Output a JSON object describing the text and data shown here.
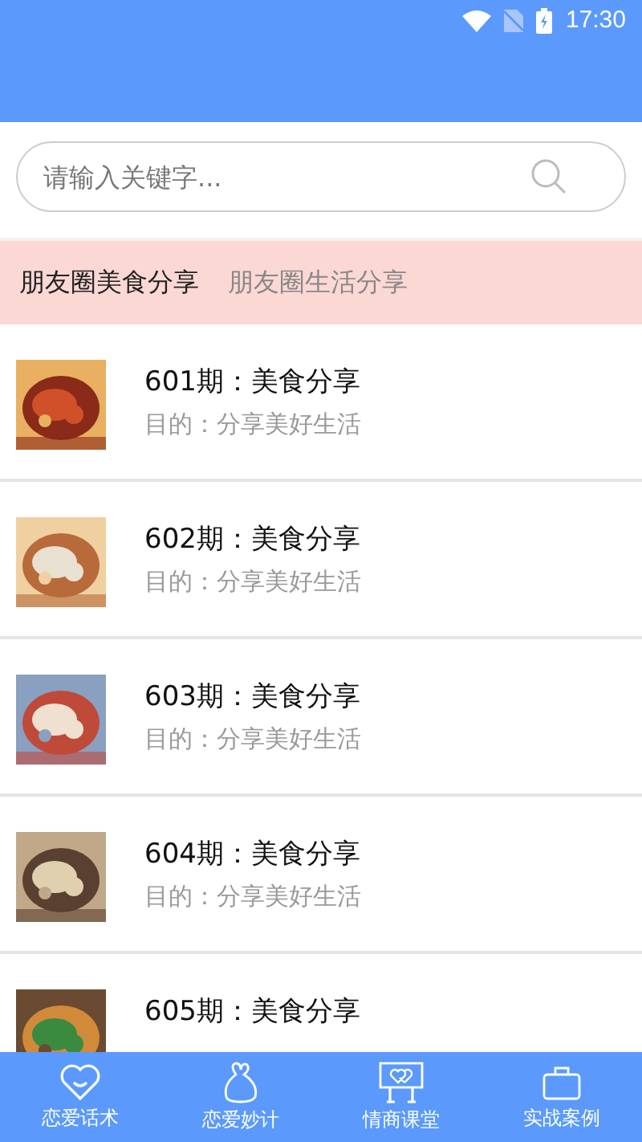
{
  "status_bar": {
    "time": "17:30"
  },
  "search": {
    "placeholder": "请输入关键字..."
  },
  "tabs": [
    {
      "label": "朋友圈美食分享",
      "selected": true
    },
    {
      "label": "朋友圈生活分享",
      "selected": false
    }
  ],
  "items": [
    {
      "title": "601期：美食分享",
      "subtitle": "目的：分享美好生活"
    },
    {
      "title": "602期：美食分享",
      "subtitle": "目的：分享美好生活"
    },
    {
      "title": "603期：美食分享",
      "subtitle": "目的：分享美好生活"
    },
    {
      "title": "604期：美食分享",
      "subtitle": "目的：分享美好生活"
    },
    {
      "title": "605期：美食分享"
    }
  ],
  "nav": [
    {
      "label": "恋爱话术",
      "kind": "heart"
    },
    {
      "label": "恋爱妙计",
      "kind": "bag"
    },
    {
      "label": "情商课堂",
      "kind": "board"
    },
    {
      "label": "实战案例",
      "kind": "case"
    }
  ]
}
